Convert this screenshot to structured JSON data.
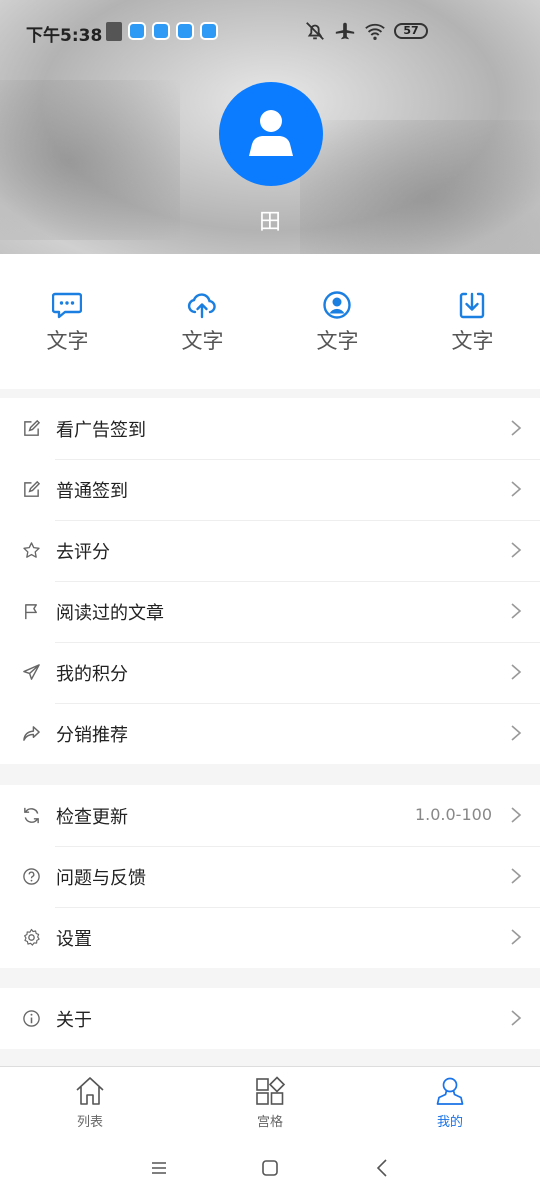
{
  "status_bar": {
    "time": "下午5:38",
    "battery": "57"
  },
  "profile": {
    "name": "田"
  },
  "quick_actions": [
    {
      "label": "文字",
      "icon": "message-icon"
    },
    {
      "label": "文字",
      "icon": "cloud-upload-icon"
    },
    {
      "label": "文字",
      "icon": "user-circle-icon"
    },
    {
      "label": "文字",
      "icon": "download-icon"
    }
  ],
  "menu_group_1": [
    {
      "label": "看广告签到",
      "icon": "edit-icon"
    },
    {
      "label": "普通签到",
      "icon": "edit-icon"
    },
    {
      "label": "去评分",
      "icon": "star-icon"
    },
    {
      "label": "阅读过的文章",
      "icon": "flag-icon"
    },
    {
      "label": "我的积分",
      "icon": "send-icon"
    },
    {
      "label": "分销推荐",
      "icon": "share-icon"
    }
  ],
  "menu_group_2": [
    {
      "label": "检查更新",
      "icon": "refresh-icon",
      "value": "1.0.0-100"
    },
    {
      "label": "问题与反馈",
      "icon": "question-icon"
    },
    {
      "label": "设置",
      "icon": "gear-icon"
    }
  ],
  "menu_group_3": [
    {
      "label": "关于",
      "icon": "info-icon"
    }
  ],
  "tabbar": [
    {
      "label": "列表",
      "icon": "home-icon",
      "active": false
    },
    {
      "label": "宫格",
      "icon": "grid-icon",
      "active": false
    },
    {
      "label": "我的",
      "icon": "person-icon",
      "active": true
    }
  ],
  "colors": {
    "accent": "#0b7cff",
    "tab_active": "#1a73e8",
    "quick_icon": "#1a7fe0"
  }
}
